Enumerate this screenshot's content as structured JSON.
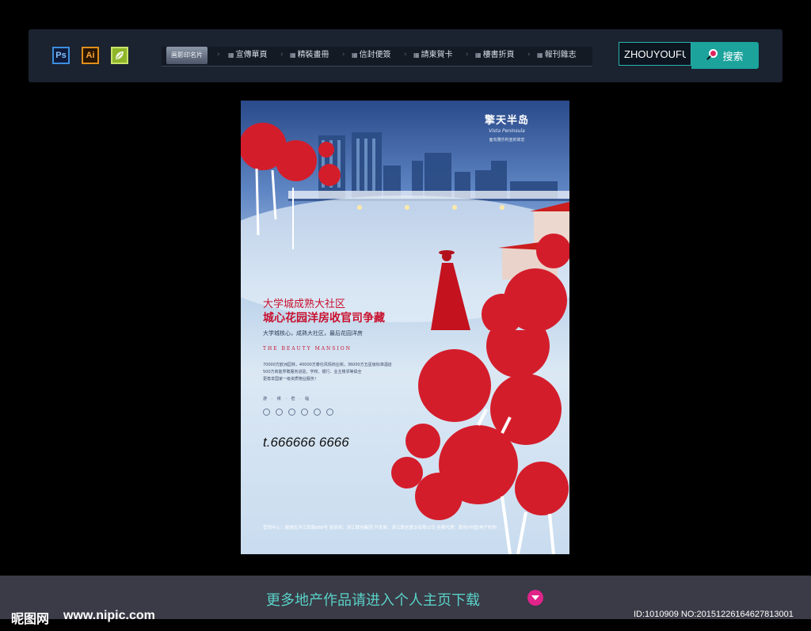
{
  "toolbar": {
    "apps": [
      {
        "label": "Ps"
      },
      {
        "label": "Ai"
      }
    ],
    "nav": [
      {
        "label": "画影印名片"
      },
      {
        "label": "宣傳單頁"
      },
      {
        "label": "精裝畫冊"
      },
      {
        "label": "信封便簽"
      },
      {
        "label": "請柬賀卡"
      },
      {
        "label": "樓書折頁"
      },
      {
        "label": "報刊雜志"
      }
    ],
    "search_value": "ZHOUYOUFU",
    "search_label": "搜索"
  },
  "poster": {
    "brand_name": "擎天半岛",
    "brand_script": "Vista Peninsula",
    "brand_tag": "面向雅乐利亚的高宏",
    "headline1": "大学城成熟大社区",
    "headline2": "城心花园洋房收官司争藏",
    "sub1": "大学城核心，成熟大社区，最后花园洋房",
    "en_line": "THE BEAUTY MANSION",
    "body": [
      "70000方欧洲园林，40000方泰伦风情商业街，36000方五星级标准酒店",
      "500方商能界聘服务进驻，学校、银行、业主楼邻等俱全",
      "更尊享国家一级资质物业服务！"
    ],
    "features": "游 · 候 · 莅 · 临",
    "phone": "t.666666 6666",
    "footer": "营销中心：越城区洋江西路888号  投资商：浙江联创集团  开发商：浙江联创置业有限公司  全案代理：联创(中国)地产机构"
  },
  "bottom": {
    "promo": "更多地产作品请进入个人主页下载",
    "logo": "昵图网",
    "url": "www.nipic.com",
    "id": "ID:1010909 NO:20151226164627813001"
  },
  "colors": {
    "accent": "#1ba39c",
    "headline": "#c8102e",
    "promo": "#5ad2c9"
  }
}
